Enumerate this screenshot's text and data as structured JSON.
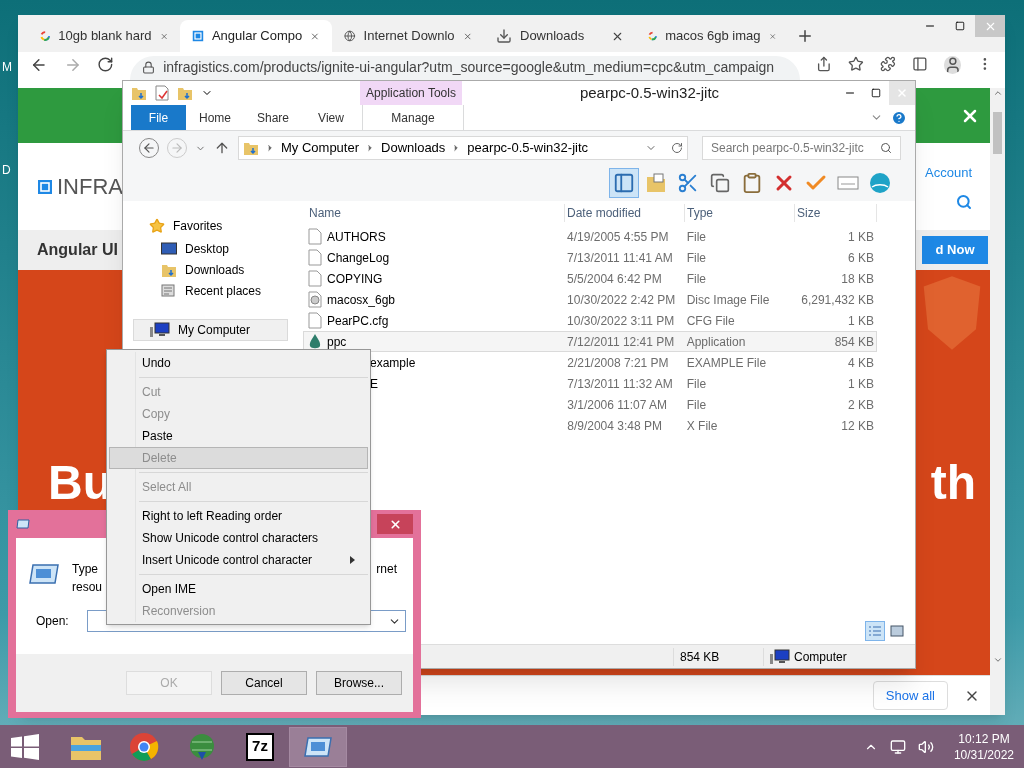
{
  "desktop": {
    "icon_labels": [
      "M",
      "D"
    ]
  },
  "browser": {
    "tabs": [
      {
        "title": "10gb blank hard",
        "kind": "search",
        "selected": false
      },
      {
        "title": "Angular Compo",
        "kind": "site",
        "selected": true
      },
      {
        "title": "Internet Downlo",
        "kind": "web",
        "selected": false
      },
      {
        "title": "Downloads",
        "kind": "downloads",
        "selected": false
      },
      {
        "title": "macos 6gb imag",
        "kind": "search",
        "selected": false
      }
    ],
    "address": "infragistics.com/products/ignite-ui-angular?utm_source=google&utm_medium=cpc&utm_campaign",
    "page": {
      "logo": "INFRA",
      "account_link": "Account",
      "heading": "Angular UI",
      "cta": "d Now",
      "hero_left": "Bu",
      "hero_right": "th"
    },
    "downloads_bar": {
      "show_all": "Show all"
    }
  },
  "explorer": {
    "title": "pearpc-0.5-win32-jitc",
    "context_group": "Application Tools",
    "ribbon_tabs": [
      {
        "label": "File",
        "kind": "file"
      },
      {
        "label": "Home",
        "kind": "tab"
      },
      {
        "label": "Share",
        "kind": "tab"
      },
      {
        "label": "View",
        "kind": "tab"
      },
      {
        "label": "Manage",
        "kind": "context"
      }
    ],
    "breadcrumb": [
      "My Computer",
      "Downloads",
      "pearpc-0.5-win32-jitc"
    ],
    "search_placeholder": "Search pearpc-0.5-win32-jitc",
    "toolbar": [
      {
        "kind": "pane",
        "selected": true
      },
      {
        "kind": "folder",
        "selected": false
      },
      {
        "kind": "cut",
        "selected": false
      },
      {
        "kind": "copy",
        "selected": false
      },
      {
        "kind": "paste",
        "selected": false
      },
      {
        "kind": "delete",
        "selected": false
      },
      {
        "kind": "check",
        "selected": false
      },
      {
        "kind": "rename",
        "selected": false
      },
      {
        "kind": "shell",
        "selected": false
      }
    ],
    "nav": [
      {
        "label": "Favorites",
        "kind": "favorites",
        "selected": false,
        "children": [
          {
            "label": "Desktop",
            "kind": "desktop",
            "selected": false
          },
          {
            "label": "Downloads",
            "kind": "downloads",
            "selected": false
          },
          {
            "label": "Recent places",
            "kind": "recent",
            "selected": false
          }
        ]
      },
      {
        "label": "My Computer",
        "kind": "computer",
        "selected": true
      }
    ],
    "columns": [
      "Name",
      "Date modified",
      "Type",
      "Size"
    ],
    "rows": [
      {
        "kind": "file",
        "name": "AUTHORS",
        "date": "4/19/2005 4:55 PM",
        "type": "File",
        "size": "1 KB",
        "selected": false
      },
      {
        "kind": "file",
        "name": "ChangeLog",
        "date": "7/13/2011 11:41 AM",
        "type": "File",
        "size": "6 KB",
        "selected": false
      },
      {
        "kind": "file",
        "name": "COPYING",
        "date": "5/5/2004 6:42 PM",
        "type": "File",
        "size": "18 KB",
        "selected": false
      },
      {
        "kind": "disc",
        "name": "macosx_6gb",
        "date": "10/30/2022 2:42 PM",
        "type": "Disc Image File",
        "size": "6,291,432 KB",
        "selected": false
      },
      {
        "kind": "file",
        "name": "PearPC.cfg",
        "date": "10/30/2022 3:11 PM",
        "type": "CFG File",
        "size": "1 KB",
        "selected": false
      },
      {
        "kind": "app",
        "name": "ppc",
        "date": "7/12/2011 12:41 PM",
        "type": "Application",
        "size": "854 KB",
        "selected": true
      },
      {
        "kind": "covered",
        "name": "example",
        "date": "2/21/2008 7:21 PM",
        "type": "EXAMPLE File",
        "size": "4 KB",
        "selected": false
      },
      {
        "kind": "covered",
        "name": "E",
        "date": "7/13/2011 11:32 AM",
        "type": "File",
        "size": "1 KB",
        "selected": false
      },
      {
        "kind": "covered",
        "date": "3/1/2006 11:07 AM",
        "type": "File",
        "size": "2 KB",
        "selected": false
      },
      {
        "kind": "covered",
        "date": "8/9/2004 3:48 PM",
        "type": "X File",
        "size": "12 KB",
        "selected": false
      }
    ],
    "view_buttons": [
      {
        "kind": "details",
        "selected": true
      },
      {
        "kind": "large",
        "selected": false
      }
    ],
    "status": {
      "size": "854 KB",
      "location": "Computer"
    }
  },
  "run_dialog": {
    "description": {
      "line_1_start": "Type",
      "line_1_end": "rnet",
      "line_2_start": "resou"
    },
    "open_label": "Open:",
    "buttons": [
      {
        "label": "OK",
        "disabled": true
      },
      {
        "label": "Cancel",
        "disabled": false
      },
      {
        "label": "Browse...",
        "disabled": false
      }
    ]
  },
  "context_menu": {
    "items": [
      {
        "kind": "item",
        "label": "Undo",
        "disabled": false,
        "selected": false
      },
      {
        "kind": "separator"
      },
      {
        "kind": "item",
        "label": "Cut",
        "disabled": true,
        "selected": false
      },
      {
        "kind": "item",
        "label": "Copy",
        "disabled": true,
        "selected": false
      },
      {
        "kind": "item",
        "label": "Paste",
        "disabled": false,
        "selected": false
      },
      {
        "kind": "item",
        "label": "Delete",
        "disabled": true,
        "selected": true
      },
      {
        "kind": "separator"
      },
      {
        "kind": "item",
        "label": "Select All",
        "disabled": true,
        "selected": false
      },
      {
        "kind": "separator"
      },
      {
        "kind": "item",
        "label": "Right to left Reading order",
        "disabled": false,
        "selected": false
      },
      {
        "kind": "item",
        "label": "Show Unicode control characters",
        "disabled": false,
        "selected": false
      },
      {
        "kind": "item",
        "label": "Insert Unicode control character",
        "disabled": false,
        "selected": false,
        "submenu": true
      },
      {
        "kind": "separator"
      },
      {
        "kind": "item",
        "label": "Open IME",
        "disabled": false,
        "selected": false
      },
      {
        "kind": "item",
        "label": "Reconversion",
        "disabled": true,
        "selected": false
      }
    ]
  },
  "taskbar": {
    "apps": [
      {
        "kind": "explorer",
        "active": false
      },
      {
        "kind": "chrome",
        "active": false
      },
      {
        "kind": "idm",
        "active": false
      },
      {
        "kind": "archiver",
        "label": "7z",
        "active": false
      },
      {
        "kind": "run",
        "active": true
      }
    ],
    "clock": {
      "time": "10:12 PM",
      "date": "10/31/2022"
    }
  }
}
